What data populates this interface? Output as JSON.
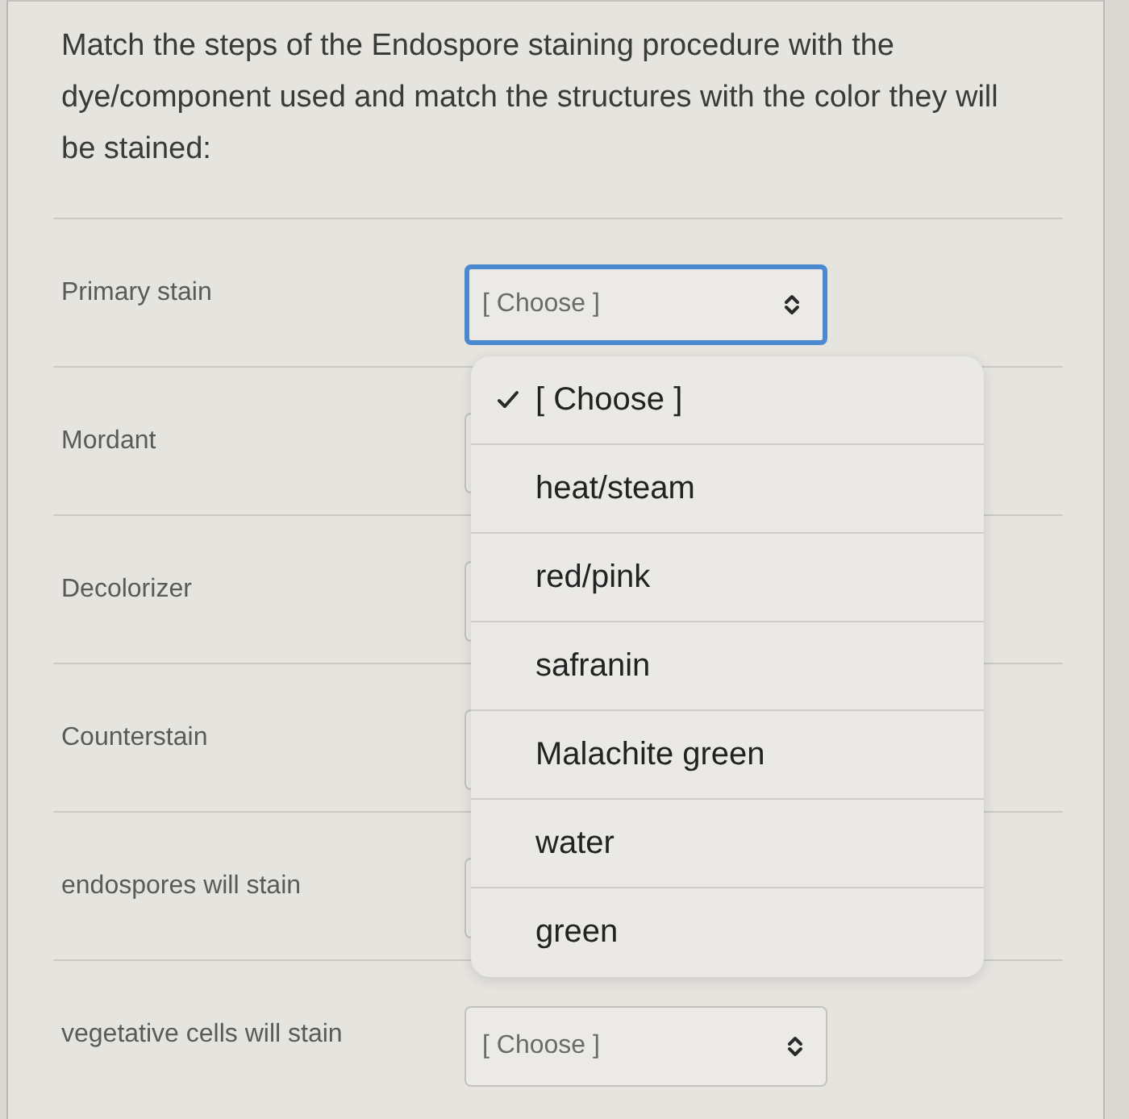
{
  "question": {
    "text": "Match the steps of the Endospore staining procedure with the dye/component used and match the structures with the color they will be stained:"
  },
  "rows": [
    {
      "label": "Primary stain",
      "select": {
        "value": "[ Choose ]",
        "focused": true,
        "open": true,
        "options": [
          {
            "label": "[ Choose ]",
            "selected": true
          },
          {
            "label": "heat/steam",
            "selected": false
          },
          {
            "label": "red/pink",
            "selected": false
          },
          {
            "label": "safranin",
            "selected": false
          },
          {
            "label": "Malachite green",
            "selected": false
          },
          {
            "label": "water",
            "selected": false
          },
          {
            "label": "green",
            "selected": false
          }
        ]
      }
    },
    {
      "label": "Mordant",
      "select": {
        "focused": false
      }
    },
    {
      "label": "Decolorizer",
      "select": {
        "focused": false
      }
    },
    {
      "label": "Counterstain",
      "select": {
        "focused": false
      }
    },
    {
      "label": "endospores will stain",
      "select": {
        "focused": false
      }
    },
    {
      "label": "vegetative cells will stain",
      "select": {
        "value": "[ Choose ]",
        "focused": false
      }
    }
  ]
}
